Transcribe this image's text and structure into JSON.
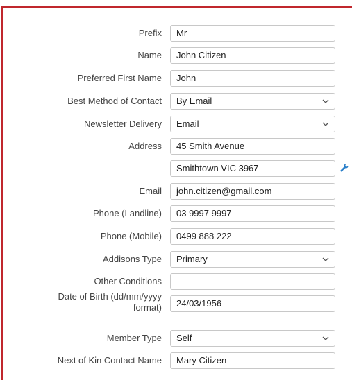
{
  "form": {
    "prefix": {
      "label": "Prefix",
      "value": "Mr"
    },
    "name": {
      "label": "Name",
      "value": "John Citizen"
    },
    "preferred_first_name": {
      "label": "Preferred First Name",
      "value": "John"
    },
    "best_method_of_contact": {
      "label": "Best Method of Contact",
      "value": "By Email"
    },
    "newsletter_delivery": {
      "label": "Newsletter Delivery",
      "value": "Email"
    },
    "address": {
      "label": "Address",
      "line1": "45 Smith Avenue",
      "line2": "Smithtown VIC 3967"
    },
    "email": {
      "label": "Email",
      "value": "john.citizen@gmail.com"
    },
    "phone_landline": {
      "label": "Phone (Landline)",
      "value": "03 9997 9997"
    },
    "phone_mobile": {
      "label": "Phone (Mobile)",
      "value": "0499 888 222"
    },
    "addisons_type": {
      "label": "Addisons Type",
      "value": "Primary"
    },
    "other_conditions": {
      "label": "Other Conditions",
      "value": ""
    },
    "date_of_birth": {
      "label_line1": "Date of Birth (dd/mm/yyyy",
      "label_line2": "format)",
      "value": "24/03/1956"
    },
    "member_type": {
      "label": "Member Type",
      "value": "Self"
    },
    "next_of_kin_contact_name": {
      "label": "Next of Kin Contact Name",
      "value": "Mary Citizen"
    }
  },
  "icons": {
    "address_lookup": "wrench-icon",
    "dropdown": "chevron-down-icon"
  },
  "colors": {
    "frame_border": "#c0272d",
    "wrench": "#2a7fc9"
  }
}
